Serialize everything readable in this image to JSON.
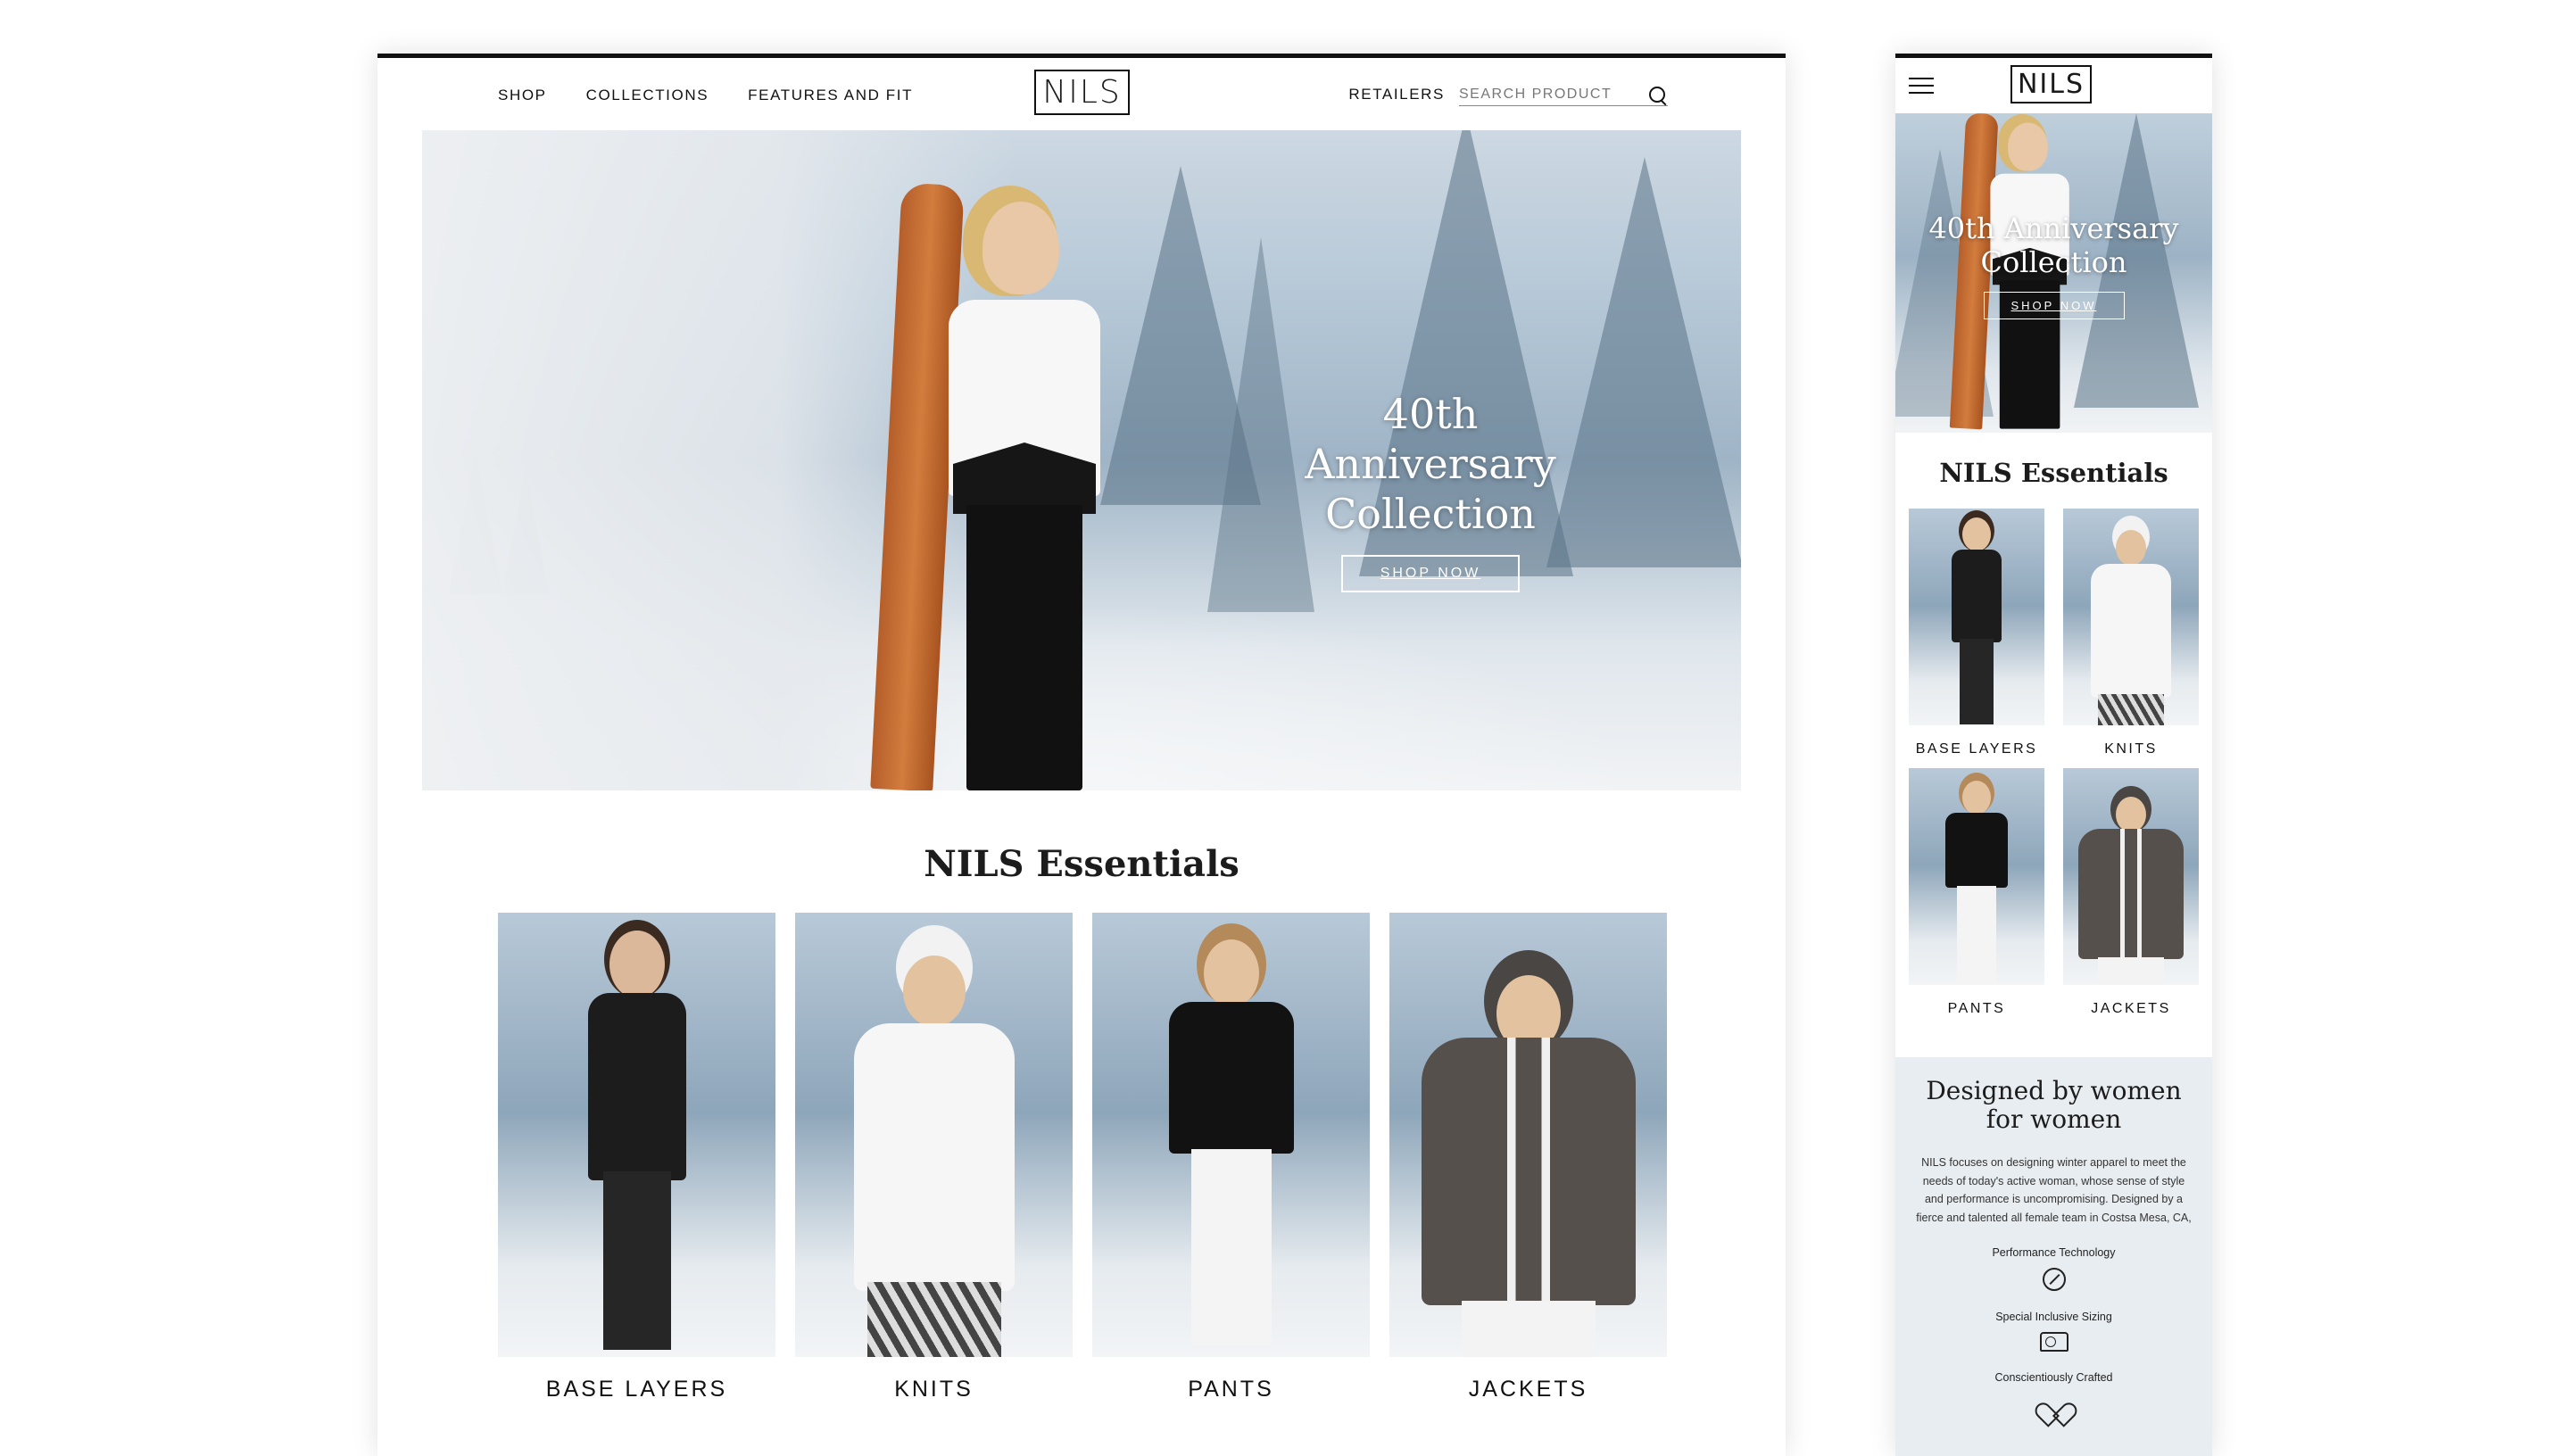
{
  "desktop": {
    "nav": {
      "items": [
        {
          "label": "SHOP"
        },
        {
          "label": "COLLECTIONS"
        },
        {
          "label": "FEATURES AND FIT"
        }
      ],
      "retailers": "RETAILERS",
      "search_placeholder": "SEARCH PRODUCT",
      "logo": "NILS"
    },
    "hero": {
      "title": "40th Anniversary Collection",
      "button": "SHOP NOW"
    },
    "essentials": {
      "title": "NILS Essentials",
      "cards": [
        {
          "label": "BASE LAYERS"
        },
        {
          "label": "KNITS"
        },
        {
          "label": "PANTS"
        },
        {
          "label": "JACKETS"
        }
      ]
    }
  },
  "mobile": {
    "logo": "NILS",
    "hero": {
      "title": "40th Anniversary Collection",
      "button": "SHOP NOW"
    },
    "essentials": {
      "title": "NILS Essentials",
      "cards": [
        {
          "label": "BASE LAYERS"
        },
        {
          "label": "KNITS"
        },
        {
          "label": "PANTS"
        },
        {
          "label": "JACKETS"
        }
      ]
    },
    "about": {
      "title": "Designed by women for women",
      "body": "NILS focuses on designing winter apparel to meet the needs of today's active woman, whose sense of style and performance is uncompromising. Designed by a fierce and talented all female team in Costsa Mesa, CA,",
      "features": [
        {
          "label": "Performance Technology",
          "icon": "performance-icon"
        },
        {
          "label": "Special Inclusive Sizing",
          "icon": "measuring-tape-icon"
        },
        {
          "label": "Conscientiously Crafted",
          "icon": "heart-hands-icon"
        }
      ]
    }
  }
}
